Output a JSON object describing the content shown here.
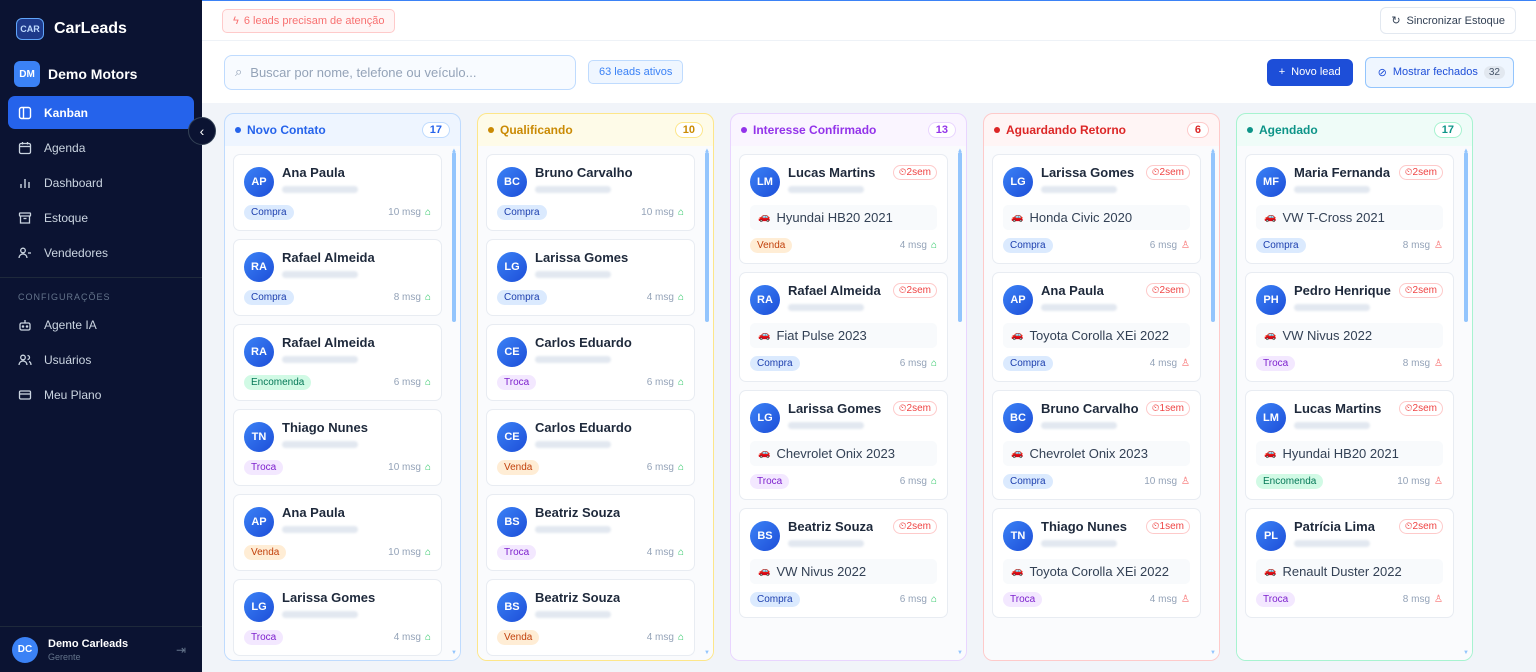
{
  "app": {
    "brand": "CarLeads",
    "logo_text": "CAR",
    "org_initials": "DM",
    "org_name": "Demo Motors"
  },
  "nav": {
    "items": [
      {
        "label": "Kanban",
        "icon": "kanban-icon",
        "active": true
      },
      {
        "label": "Agenda",
        "icon": "calendar-icon"
      },
      {
        "label": "Dashboard",
        "icon": "chart-icon"
      },
      {
        "label": "Estoque",
        "icon": "archive-icon"
      },
      {
        "label": "Vendedores",
        "icon": "users-icon"
      }
    ],
    "section_title": "CONFIGURAÇÕES",
    "settings": [
      {
        "label": "Agente IA",
        "icon": "bot-icon"
      },
      {
        "label": "Usuários",
        "icon": "user-group-icon"
      },
      {
        "label": "Meu Plano",
        "icon": "credit-card-icon"
      }
    ]
  },
  "user": {
    "initials": "DC",
    "name": "Demo Carleads",
    "role": "Gerente"
  },
  "topbar": {
    "alert": "6 leads precisam de atenção",
    "sync_label": "Sincronizar Estoque"
  },
  "toolbar": {
    "search_placeholder": "Buscar por nome, telefone ou veículo...",
    "active_leads": "63 leads ativos",
    "new_lead_label": "Novo lead",
    "show_closed_label": "Mostrar fechados",
    "closed_count": "32"
  },
  "colors": {
    "accent": "#2563eb",
    "sidebar": "#0b1332"
  },
  "columns": [
    {
      "title": "Novo Contato",
      "count": "17",
      "color": "#2563eb",
      "bg": "#eef5ff",
      "border": "#bfdbfe",
      "cards": [
        {
          "initials": "AP",
          "name": "Ana Paula",
          "tag": "Compra",
          "tag_class": "compra",
          "msgs": "10 msg",
          "agent": "bot"
        },
        {
          "initials": "RA",
          "name": "Rafael Almeida",
          "tag": "Compra",
          "tag_class": "compra",
          "msgs": "8 msg",
          "agent": "bot"
        },
        {
          "initials": "RA",
          "name": "Rafael Almeida",
          "tag": "Encomenda",
          "tag_class": "encomenda",
          "msgs": "6 msg",
          "agent": "bot"
        },
        {
          "initials": "TN",
          "name": "Thiago Nunes",
          "tag": "Troca",
          "tag_class": "troca",
          "msgs": "10 msg",
          "agent": "bot"
        },
        {
          "initials": "AP",
          "name": "Ana Paula",
          "tag": "Venda",
          "tag_class": "venda",
          "msgs": "10 msg",
          "agent": "bot"
        },
        {
          "initials": "LG",
          "name": "Larissa Gomes",
          "tag": "Troca",
          "tag_class": "troca",
          "msgs": "4 msg",
          "agent": "bot"
        }
      ]
    },
    {
      "title": "Qualificando",
      "count": "10",
      "color": "#ca8a04",
      "bg": "#fefbe8",
      "border": "#fde68a",
      "cards": [
        {
          "initials": "BC",
          "name": "Bruno Carvalho",
          "tag": "Compra",
          "tag_class": "compra",
          "msgs": "10 msg",
          "agent": "bot"
        },
        {
          "initials": "LG",
          "name": "Larissa Gomes",
          "tag": "Compra",
          "tag_class": "compra",
          "msgs": "4 msg",
          "agent": "bot"
        },
        {
          "initials": "CE",
          "name": "Carlos Eduardo",
          "tag": "Troca",
          "tag_class": "troca",
          "msgs": "6 msg",
          "agent": "bot"
        },
        {
          "initials": "CE",
          "name": "Carlos Eduardo",
          "tag": "Venda",
          "tag_class": "venda",
          "msgs": "6 msg",
          "agent": "bot"
        },
        {
          "initials": "BS",
          "name": "Beatriz Souza",
          "tag": "Troca",
          "tag_class": "troca",
          "msgs": "4 msg",
          "agent": "bot"
        },
        {
          "initials": "BS",
          "name": "Beatriz Souza",
          "tag": "Venda",
          "tag_class": "venda",
          "msgs": "4 msg",
          "agent": "bot"
        }
      ]
    },
    {
      "title": "Interesse Confirmado",
      "count": "13",
      "color": "#9333ea",
      "bg": "#faf5ff",
      "border": "#e9d5ff",
      "cards": [
        {
          "initials": "LM",
          "name": "Lucas Martins",
          "time": "2sem",
          "vehicle": "Hyundai HB20 2021",
          "tag": "Venda",
          "tag_class": "venda",
          "msgs": "4 msg",
          "agent": "bot"
        },
        {
          "initials": "RA",
          "name": "Rafael Almeida",
          "time": "2sem",
          "vehicle": "Fiat Pulse 2023",
          "tag": "Compra",
          "tag_class": "compra",
          "msgs": "6 msg",
          "agent": "bot"
        },
        {
          "initials": "LG",
          "name": "Larissa Gomes",
          "time": "2sem",
          "vehicle": "Chevrolet Onix 2023",
          "tag": "Troca",
          "tag_class": "troca",
          "msgs": "6 msg",
          "agent": "bot"
        },
        {
          "initials": "BS",
          "name": "Beatriz Souza",
          "time": "2sem",
          "vehicle": "VW Nivus 2022",
          "tag": "Compra",
          "tag_class": "compra",
          "msgs": "6 msg",
          "agent": "bot"
        }
      ]
    },
    {
      "title": "Aguardando Retorno",
      "count": "6",
      "color": "#dc2626",
      "bg": "#fff5f5",
      "border": "#fecaca",
      "cards": [
        {
          "initials": "LG",
          "name": "Larissa Gomes",
          "time": "2sem",
          "vehicle": "Honda Civic 2020",
          "tag": "Compra",
          "tag_class": "compra",
          "msgs": "6 msg",
          "agent": "person"
        },
        {
          "initials": "AP",
          "name": "Ana Paula",
          "time": "2sem",
          "vehicle": "Toyota Corolla XEi 2022",
          "tag": "Compra",
          "tag_class": "compra",
          "msgs": "4 msg",
          "agent": "person"
        },
        {
          "initials": "BC",
          "name": "Bruno Carvalho",
          "time": "1sem",
          "vehicle": "Chevrolet Onix 2023",
          "tag": "Compra",
          "tag_class": "compra",
          "msgs": "10 msg",
          "agent": "person"
        },
        {
          "initials": "TN",
          "name": "Thiago Nunes",
          "time": "1sem",
          "vehicle": "Toyota Corolla XEi 2022",
          "tag": "Troca",
          "tag_class": "troca",
          "msgs": "4 msg",
          "agent": "person"
        }
      ]
    },
    {
      "title": "Agendado",
      "count": "17",
      "color": "#0d9488",
      "bg": "#effcf8",
      "border": "#a7f3d0",
      "cards": [
        {
          "initials": "MF",
          "name": "Maria Fernanda",
          "time": "2sem",
          "vehicle": "VW T-Cross 2021",
          "tag": "Compra",
          "tag_class": "compra",
          "msgs": "8 msg",
          "agent": "person"
        },
        {
          "initials": "PH",
          "name": "Pedro Henrique",
          "time": "2sem",
          "vehicle": "VW Nivus 2022",
          "tag": "Troca",
          "tag_class": "troca",
          "msgs": "8 msg",
          "agent": "person"
        },
        {
          "initials": "LM",
          "name": "Lucas Martins",
          "time": "2sem",
          "vehicle": "Hyundai HB20 2021",
          "tag": "Encomenda",
          "tag_class": "encomenda",
          "msgs": "10 msg",
          "agent": "person"
        },
        {
          "initials": "PL",
          "name": "Patrícia Lima",
          "time": "2sem",
          "vehicle": "Renault Duster 2022",
          "tag": "Troca",
          "tag_class": "troca",
          "msgs": "8 msg",
          "agent": "person"
        }
      ]
    }
  ]
}
